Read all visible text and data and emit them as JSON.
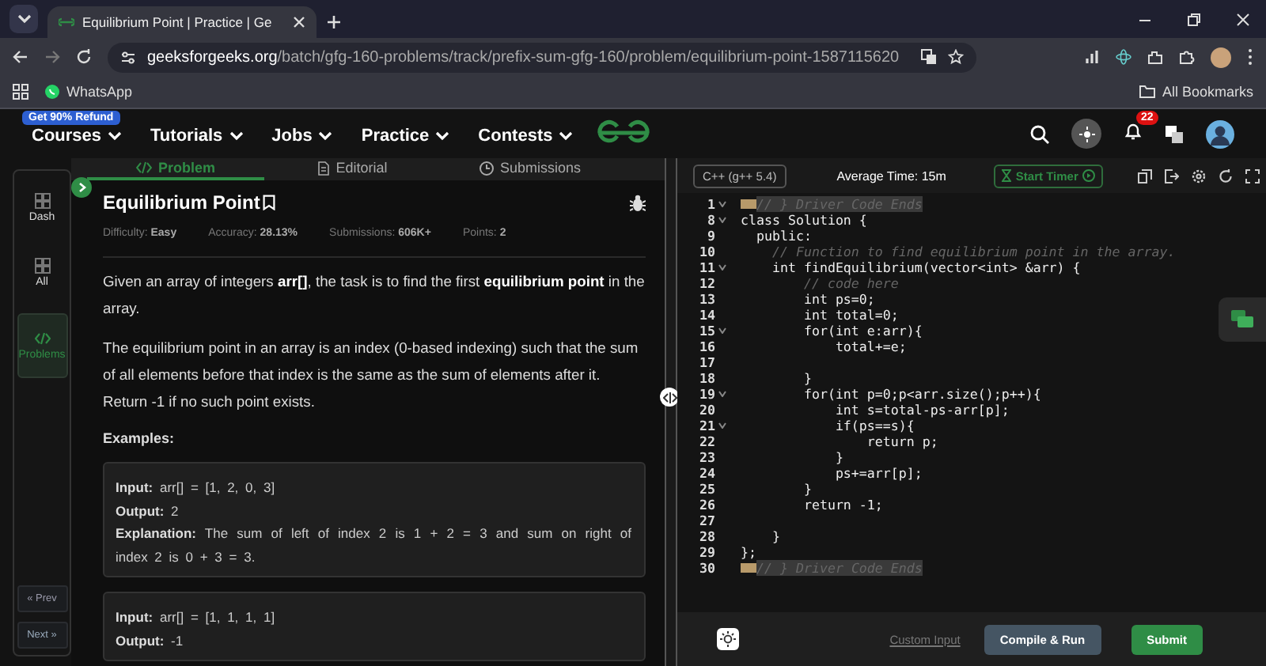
{
  "browser": {
    "tab_title": "Equilibrium Point | Practice | Ge",
    "url_host": "geeksforgeeks.org",
    "url_path": "/batch/gfg-160-problems/track/prefix-sum-gfg-160/problem/equilibrium-point-1587115620",
    "bookmarks": [
      "WhatsApp"
    ],
    "all_bookmarks": "All Bookmarks"
  },
  "site_nav": {
    "promo": "Get 90% Refund",
    "menus": [
      "Courses",
      "Tutorials",
      "Jobs",
      "Practice",
      "Contests"
    ],
    "notification_count": "22"
  },
  "side_nav": {
    "items": [
      {
        "label": "Dash",
        "selected": false
      },
      {
        "label": "All",
        "selected": false
      },
      {
        "label": "Problems",
        "selected": true
      }
    ],
    "prev": "« Prev",
    "next": "Next »"
  },
  "problem_tabs": [
    {
      "label": "Problem",
      "selected": true
    },
    {
      "label": "Editorial",
      "selected": false
    },
    {
      "label": "Submissions",
      "selected": false
    }
  ],
  "problem": {
    "title": "Equilibrium Point",
    "meta": [
      {
        "label": "Difficulty:",
        "value": "Easy"
      },
      {
        "label": "Accuracy:",
        "value": "28.13%"
      },
      {
        "label": "Submissions:",
        "value": "606K+"
      },
      {
        "label": "Points:",
        "value": "2"
      }
    ],
    "paragraphs": [
      "Given an array of integers **arr[]**, the task is to find the first **equilibrium point** in the array.",
      "The equilibrium point in an array is an index (0-based indexing) such that the sum of all elements before that index is the same as the sum of elements after it. Return -1 if no such point exists."
    ],
    "examples_heading": "Examples:",
    "examples": [
      {
        "lines": [
          "**Input:** arr[] = [1, 2, 0, 3]",
          "**Output:** 2",
          "**Explanation:** The sum of left of index 2 is 1 + 2 = 3 and sum on right of index 2 is 0 + 3 = 3."
        ]
      },
      {
        "lines": [
          "**Input:** arr[] = [1, 1, 1, 1]",
          "**Output:** -1"
        ]
      }
    ]
  },
  "editor": {
    "language": "C++ (g++ 5.4)",
    "average_time": "Average Time: 15m",
    "timer_button": "Start Timer",
    "lines": [
      {
        "num": "1",
        "kind": "fold",
        "foldable": true,
        "text": "// } Driver Code Ends"
      },
      {
        "num": "8",
        "kind": "code",
        "foldable": true,
        "text": "class Solution {"
      },
      {
        "num": "9",
        "kind": "code",
        "foldable": false,
        "text": "  public:"
      },
      {
        "num": "10",
        "kind": "comment",
        "foldable": false,
        "text": "    // Function to find equilibrium point in the array."
      },
      {
        "num": "11",
        "kind": "code",
        "foldable": true,
        "text": "    int findEquilibrium(vector<int> &arr) {"
      },
      {
        "num": "12",
        "kind": "comment",
        "foldable": false,
        "text": "        // code here"
      },
      {
        "num": "13",
        "kind": "code",
        "foldable": false,
        "text": "        int ps=0;"
      },
      {
        "num": "14",
        "kind": "code",
        "foldable": false,
        "text": "        int total=0;"
      },
      {
        "num": "15",
        "kind": "code",
        "foldable": true,
        "text": "        for(int e:arr){"
      },
      {
        "num": "16",
        "kind": "code",
        "foldable": false,
        "text": "            total+=e;"
      },
      {
        "num": "17",
        "kind": "code",
        "foldable": false
      },
      {
        "num": "18",
        "kind": "code",
        "foldable": false,
        "text": "        }"
      },
      {
        "num": "19",
        "kind": "code",
        "foldable": true,
        "text": "        for(int p=0;p<arr.size();p++){"
      },
      {
        "num": "20",
        "kind": "code",
        "foldable": false,
        "text": "            int s=total-ps-arr[p];"
      },
      {
        "num": "21",
        "kind": "code",
        "foldable": true,
        "text": "            if(ps==s){"
      },
      {
        "num": "22",
        "kind": "code",
        "foldable": false,
        "text": "                return p;"
      },
      {
        "num": "23",
        "kind": "code",
        "foldable": false,
        "text": "            }"
      },
      {
        "num": "24",
        "kind": "code",
        "foldable": false,
        "text": "            ps+=arr[p];"
      },
      {
        "num": "25",
        "kind": "code",
        "foldable": false,
        "text": "        }"
      },
      {
        "num": "26",
        "kind": "code",
        "foldable": false,
        "text": "        return -1;"
      },
      {
        "num": "27",
        "kind": "code",
        "foldable": false
      },
      {
        "num": "28",
        "kind": "code",
        "foldable": false,
        "text": "    }"
      },
      {
        "num": "29",
        "kind": "code",
        "foldable": false,
        "text": "};"
      },
      {
        "num": "30",
        "kind": "fold",
        "foldable": false,
        "text": "// } Driver Code Ends"
      }
    ],
    "custom_input": "Custom Input",
    "compile_button": "Compile & Run",
    "submit_button": "Submit"
  }
}
